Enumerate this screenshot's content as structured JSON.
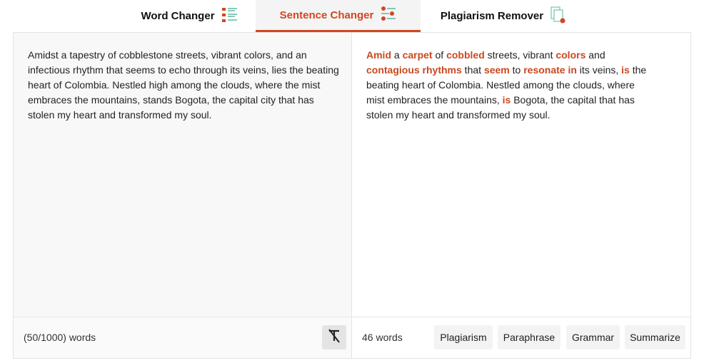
{
  "tabs": [
    {
      "label": "Word Changer",
      "icon": "list-lines-icon"
    },
    {
      "label": "Sentence Changer",
      "icon": "sliders-icon"
    },
    {
      "label": "Plagiarism Remover",
      "icon": "document-copy-icon"
    }
  ],
  "accent_color": "#d2461f",
  "input": {
    "text": "Amidst a tapestry of cobblestone streets, vibrant colors, and an infectious rhythm that seems to echo through its veins, lies the beating heart of Colombia. Nestled high among the clouds, where the mist embraces the mountains, stands Bogota, the capital city that has stolen my heart and transformed my soul.",
    "word_count": "(50/1000) words"
  },
  "output": {
    "word_count": "46 words",
    "segments": [
      {
        "text": "Amid",
        "changed": true
      },
      {
        "text": " a ",
        "changed": false
      },
      {
        "text": "carpet",
        "changed": true
      },
      {
        "text": " of ",
        "changed": false
      },
      {
        "text": "cobbled",
        "changed": true
      },
      {
        "text": " streets, vibrant ",
        "changed": false
      },
      {
        "text": "colors",
        "changed": true
      },
      {
        "text": " and ",
        "changed": false
      },
      {
        "text": "contagious rhythms",
        "changed": true
      },
      {
        "text": " that ",
        "changed": false
      },
      {
        "text": "seem",
        "changed": true
      },
      {
        "text": " to ",
        "changed": false
      },
      {
        "text": "resonate in",
        "changed": true
      },
      {
        "text": " its veins, ",
        "changed": false
      },
      {
        "text": "is",
        "changed": true
      },
      {
        "text": " the beating heart of Colombia. Nestled  among the clouds, where  mist embraces the mountains, ",
        "changed": false
      },
      {
        "text": "is",
        "changed": true
      },
      {
        "text": " Bogota, the capital that has stolen my heart and transformed my soul.",
        "changed": false
      }
    ]
  },
  "actions": {
    "plagiarism": "Plagiarism",
    "paraphrase": "Paraphrase",
    "grammar": "Grammar",
    "summarize": "Summarize"
  }
}
